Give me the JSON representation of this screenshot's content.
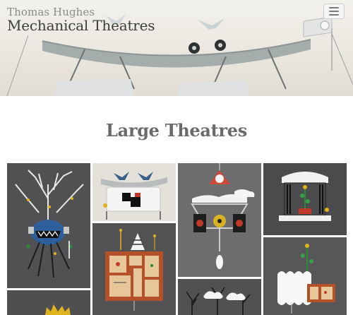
{
  "header": {
    "subtitle": "Thomas Hughes",
    "title": "Mechanical Theatres",
    "menu_icon": "hamburger-menu-icon"
  },
  "page": {
    "heading": "Large Theatres"
  },
  "gallery": {
    "items": [
      {
        "name": "gallery-image-tree-creature",
        "icon": "theatre-image"
      },
      {
        "name": "gallery-image-birds-panel",
        "icon": "theatre-image"
      },
      {
        "name": "gallery-image-dome-machine",
        "icon": "theatre-image"
      },
      {
        "name": "gallery-image-curtain-stage",
        "icon": "theatre-image"
      },
      {
        "name": "gallery-image-red-cabinet",
        "icon": "theatre-image"
      },
      {
        "name": "gallery-image-cloud-frame",
        "icon": "theatre-image"
      },
      {
        "name": "gallery-image-crown",
        "icon": "theatre-image"
      },
      {
        "name": "gallery-image-bare-trees",
        "icon": "theatre-image"
      }
    ]
  },
  "colors": {
    "tile_dark": "#4a4a4c",
    "tile_mid": "#5a5a5c",
    "tile_light": "#e6e3dc",
    "accent_red": "#c0392b",
    "accent_yellow": "#e0b21b"
  }
}
